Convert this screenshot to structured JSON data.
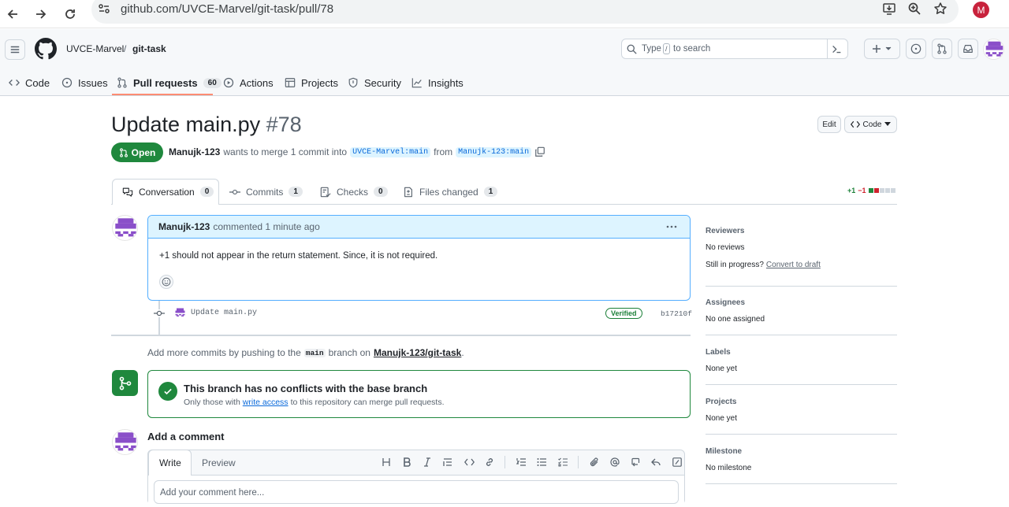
{
  "browser": {
    "url": "github.com/UVCE-Marvel/git-task/pull/78",
    "profile_initial": "M"
  },
  "header": {
    "owner": "UVCE-Marvel",
    "separator": "/",
    "repo": "git-task",
    "search_prefix": "Type",
    "search_key": "/",
    "search_suffix": "to search"
  },
  "repo_nav": {
    "tabs": [
      {
        "label": "Code",
        "icon": "code-icon"
      },
      {
        "label": "Issues",
        "icon": "issue-icon"
      },
      {
        "label": "Pull requests",
        "icon": "pull-request-icon",
        "count": "60",
        "selected": true
      },
      {
        "label": "Actions",
        "icon": "play-icon"
      },
      {
        "label": "Projects",
        "icon": "table-icon"
      },
      {
        "label": "Security",
        "icon": "shield-icon"
      },
      {
        "label": "Insights",
        "icon": "graph-icon"
      }
    ]
  },
  "pr": {
    "title": "Update main.py",
    "number": "#78",
    "edit_label": "Edit",
    "code_label": "Code",
    "state": "Open",
    "author": "Manujk-123",
    "merge_text": "wants to merge 1 commit into",
    "base_branch": "UVCE-Marvel:main",
    "from_text": "from",
    "head_branch": "Manujk-123:main",
    "tabs": [
      {
        "label": "Conversation",
        "count": "0",
        "icon": "comment-discussion-icon"
      },
      {
        "label": "Commits",
        "count": "1",
        "icon": "commit-icon"
      },
      {
        "label": "Checks",
        "count": "0",
        "icon": "checklist-icon"
      },
      {
        "label": "Files changed",
        "count": "1",
        "icon": "file-diff-icon"
      }
    ],
    "diff_add": "+1",
    "diff_del": "−1"
  },
  "comment": {
    "author": "Manujk-123",
    "meta": "commented 1 minute ago",
    "body": "+1 should not appear in the return statement. Since, it is not required."
  },
  "commit": {
    "message": "Update main.py",
    "verified_label": "Verified",
    "sha": "b17210f"
  },
  "push_hint": {
    "prefix": "Add more commits by pushing to the",
    "branch": "main",
    "middle": "branch on",
    "repo": "Manujk-123/git-task",
    "suffix": "."
  },
  "merge_box": {
    "title": "This branch has no conflicts with the base branch",
    "sub_prefix": "Only those with",
    "sub_link": "write access",
    "sub_suffix": "to this repository can merge pull requests."
  },
  "add_comment": {
    "heading": "Add a comment",
    "write_tab": "Write",
    "preview_tab": "Preview",
    "placeholder": "Add your comment here..."
  },
  "sidebar": {
    "reviewers_heading": "Reviewers",
    "reviewers_value": "No reviews",
    "in_progress": "Still in progress?",
    "convert_link": "Convert to draft",
    "assignees_heading": "Assignees",
    "assignees_value": "No one assigned",
    "labels_heading": "Labels",
    "labels_value": "None yet",
    "projects_heading": "Projects",
    "projects_value": "None yet",
    "milestone_heading": "Milestone",
    "milestone_value": "No milestone"
  },
  "colors": {
    "open_green": "#1f883d",
    "link_blue": "#0969da",
    "comment_header_bg": "#ddf4ff",
    "avatar_purple": "#8a4fc9"
  }
}
